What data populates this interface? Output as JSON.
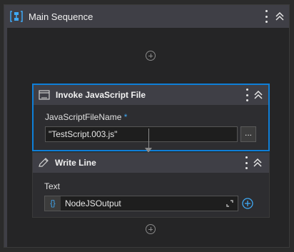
{
  "sequence": {
    "title": "Main Sequence"
  },
  "invoke_activity": {
    "title": "Invoke JavaScript File",
    "field_label": "JavaScriptFileName",
    "required_mark": "*",
    "field_value": "\"TestScript.003.js\"",
    "browse_label": "..."
  },
  "write_activity": {
    "title": "Write Line",
    "field_label": "Text",
    "var_badge": "{}",
    "field_value": "NodeJSOutput"
  },
  "colors": {
    "accent": "#0e7fd8",
    "header": "#3f3f46",
    "background": "#252526"
  }
}
